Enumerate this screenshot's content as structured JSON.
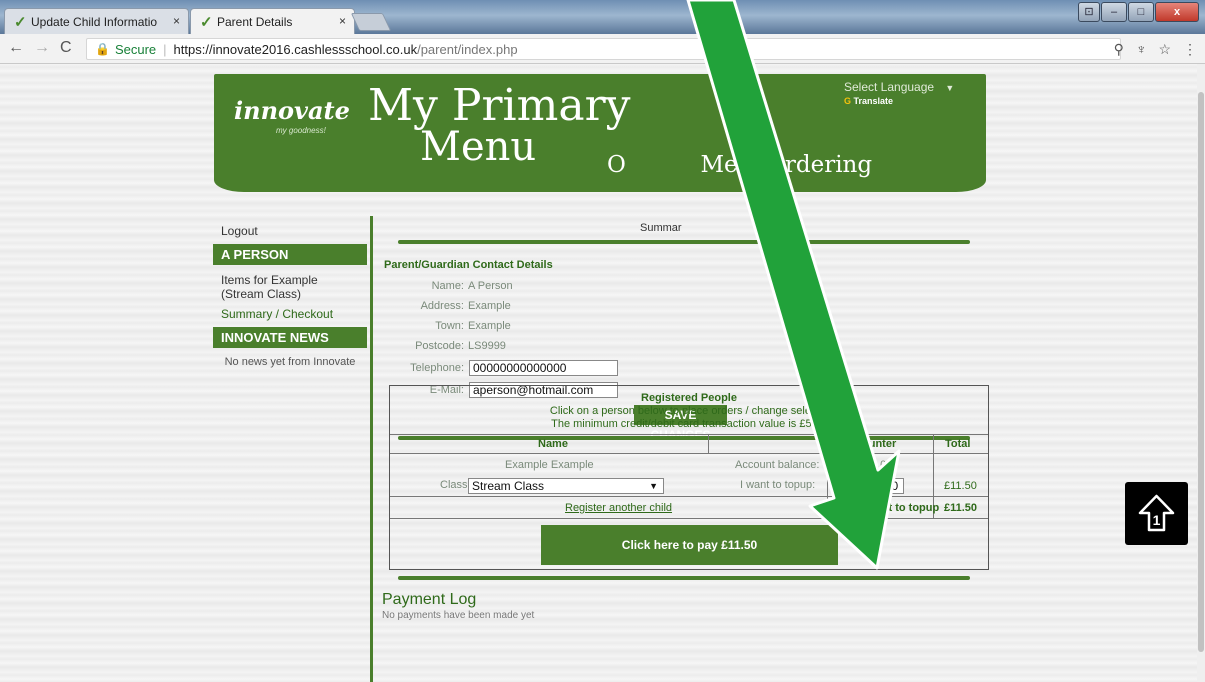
{
  "browser": {
    "tabs": [
      {
        "label": "Update Child Informatio",
        "active": false
      },
      {
        "label": "Parent Details",
        "active": true
      }
    ],
    "close_glyph": "×",
    "url_secure_label": "Secure",
    "url_host": "https://innovate2016.cashlessschool.co.uk",
    "url_path": "/parent/index.php"
  },
  "banner": {
    "logo": "innovate",
    "logo_tagline": "my goodness!",
    "title_line1": "My Primary",
    "title_line2": "Menu",
    "subtitle_left": "O",
    "subtitle_right": "Meal Ordering",
    "language_select": "Select Language",
    "powered_by_suffix": "Translate"
  },
  "sidebar": {
    "logout": "Logout",
    "person_heading": "A PERSON",
    "items_link": "Items for Example (Stream Class)",
    "summary_link": "Summary / Checkout",
    "news_heading": "INNOVATE NEWS",
    "news_note": "No news yet from Innovate"
  },
  "main": {
    "summary_title": "Summar",
    "contact_heading": "Parent/Guardian Contact Details",
    "fields": {
      "name_label": "Name:",
      "name_value": "A Person",
      "address_label": "Address:",
      "address_value": "Example",
      "town_label": "Town:",
      "town_value": "Example",
      "postcode_label": "Postcode:",
      "postcode_value": "LS9999",
      "telephone_label": "Telephone:",
      "telephone_value": "00000000000000",
      "email_label": "E-Mail:",
      "email_value": "aperson@hotmail.com"
    },
    "save_button": "SAVE CHANGES"
  },
  "registered": {
    "title": "Registered People",
    "line1": "Click on a person below to place orders / change selectio",
    "line2": "The minimum credit/debit card transaction value is £5.00",
    "col_name": "Name",
    "col_counter": "ounter",
    "col_total": "Total",
    "child_name": "Example Example",
    "account_balance_label": "Account balance:",
    "account_balance_value": "0.00",
    "class_label": "Class:",
    "class_value": "Stream Class",
    "topup_label": "I want to topup:",
    "currency": "£",
    "topup_value": "11.50",
    "row_total": "£11.50",
    "register_link": "Register another child",
    "footer_topup_label": "I want to topup",
    "footer_total": "£11.50",
    "pay_button": "Click here to pay £11.50"
  },
  "payment_log": {
    "title": "Payment Log",
    "note": "No payments have been made yet"
  },
  "colors": {
    "brand_green": "#4a7f2c",
    "annotation_arrow": "#21a23a"
  }
}
